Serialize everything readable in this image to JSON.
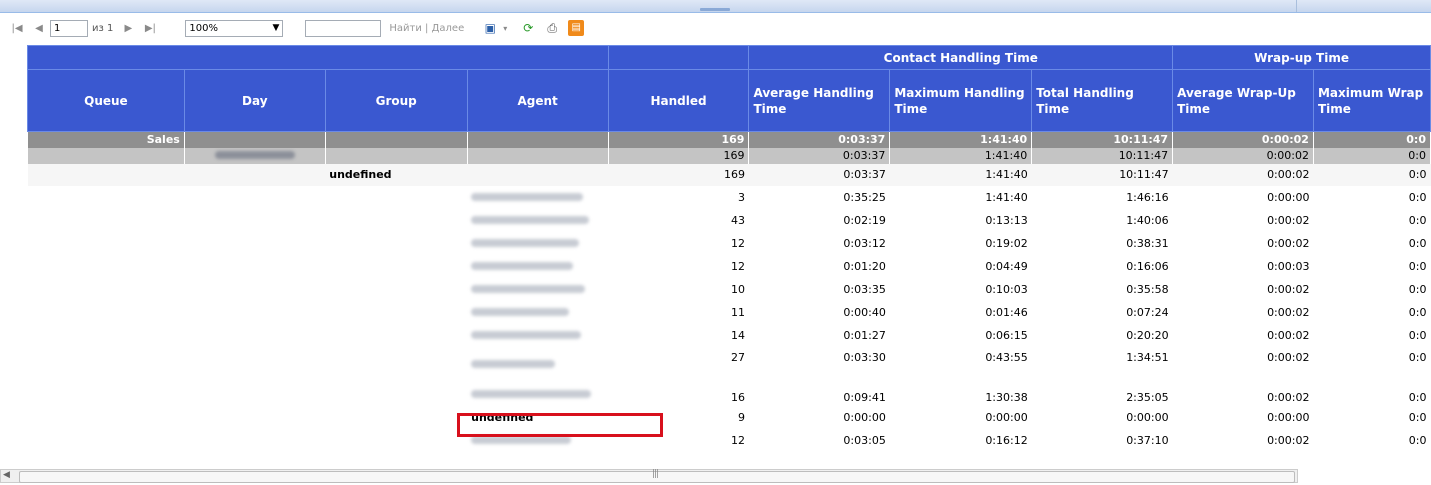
{
  "toolbar": {
    "page_input": "1",
    "page_of": "из 1",
    "zoom_value": "100%",
    "find_input": "",
    "find_label": "Найти",
    "next_label": "Далее",
    "find_separator": "|"
  },
  "table": {
    "group_headers": {
      "contact": "Contact Handling Time",
      "wrapup": "Wrap-up Time"
    },
    "columns": {
      "queue": "Queue",
      "day": "Day",
      "group": "Group",
      "agent": "Agent",
      "handled": "Handled",
      "avg_handling": "Average Handling Time",
      "max_handling": "Maximum Handling Time",
      "total_handling": "Total Handling Time",
      "avg_wrapup": "Average Wrap-Up Time",
      "max_wrapup": "Maximum Wrap Time"
    },
    "sales_row": {
      "queue": "Sales",
      "handled": "169",
      "avg": "0:03:37",
      "max": "1:41:40",
      "total": "10:11:47",
      "avg_wrap": "0:00:02",
      "max_wrap": "0:0"
    },
    "day_row": {
      "handled": "169",
      "avg": "0:03:37",
      "max": "1:41:40",
      "total": "10:11:47",
      "avg_wrap": "0:00:02",
      "max_wrap": "0:0"
    },
    "group_row": {
      "group": "undefined",
      "handled": "169",
      "avg": "0:03:37",
      "max": "1:41:40",
      "total": "10:11:47",
      "avg_wrap": "0:00:02",
      "max_wrap": "0:0"
    },
    "agents": [
      {
        "agent": "",
        "handled": "3",
        "avg": "0:35:25",
        "max": "1:41:40",
        "total": "1:46:16",
        "avg_wrap": "0:00:00",
        "max_wrap": "0:0"
      },
      {
        "agent": "",
        "handled": "43",
        "avg": "0:02:19",
        "max": "0:13:13",
        "total": "1:40:06",
        "avg_wrap": "0:00:02",
        "max_wrap": "0:0"
      },
      {
        "agent": "",
        "handled": "12",
        "avg": "0:03:12",
        "max": "0:19:02",
        "total": "0:38:31",
        "avg_wrap": "0:00:02",
        "max_wrap": "0:0"
      },
      {
        "agent": "",
        "handled": "12",
        "avg": "0:01:20",
        "max": "0:04:49",
        "total": "0:16:06",
        "avg_wrap": "0:00:03",
        "max_wrap": "0:0"
      },
      {
        "agent": "",
        "handled": "10",
        "avg": "0:03:35",
        "max": "0:10:03",
        "total": "0:35:58",
        "avg_wrap": "0:00:02",
        "max_wrap": "0:0"
      },
      {
        "agent": "",
        "handled": "11",
        "avg": "0:00:40",
        "max": "0:01:46",
        "total": "0:07:24",
        "avg_wrap": "0:00:02",
        "max_wrap": "0:0"
      },
      {
        "agent": "",
        "handled": "14",
        "avg": "0:01:27",
        "max": "0:06:15",
        "total": "0:20:20",
        "avg_wrap": "0:00:02",
        "max_wrap": "0:0"
      },
      {
        "agent": "",
        "handled": "27",
        "avg": "0:03:30",
        "max": "0:43:55",
        "total": "1:34:51",
        "avg_wrap": "0:00:02",
        "max_wrap": "0:0"
      },
      {
        "agent": "",
        "handled": "16",
        "avg": "0:09:41",
        "max": "1:30:38",
        "total": "2:35:05",
        "avg_wrap": "0:00:02",
        "max_wrap": "0:0"
      },
      {
        "agent": "undefined",
        "handled": "9",
        "avg": "0:00:00",
        "max": "0:00:00",
        "total": "0:00:00",
        "avg_wrap": "0:00:00",
        "max_wrap": "0:0"
      },
      {
        "agent": "",
        "handled": "12",
        "avg": "0:03:05",
        "max": "0:16:12",
        "total": "0:37:10",
        "avg_wrap": "0:00:02",
        "max_wrap": "0:0"
      }
    ]
  },
  "icons": {
    "first_page": "first-page-icon",
    "prev_page": "prev-page-icon",
    "next_page": "next-page-icon",
    "last_page": "last-page-icon",
    "save": "save-icon",
    "refresh": "refresh-icon",
    "print": "print-icon",
    "export": "export-icon"
  },
  "colors": {
    "header_blue": "#3a58d0",
    "highlight_red": "#d8101c"
  }
}
